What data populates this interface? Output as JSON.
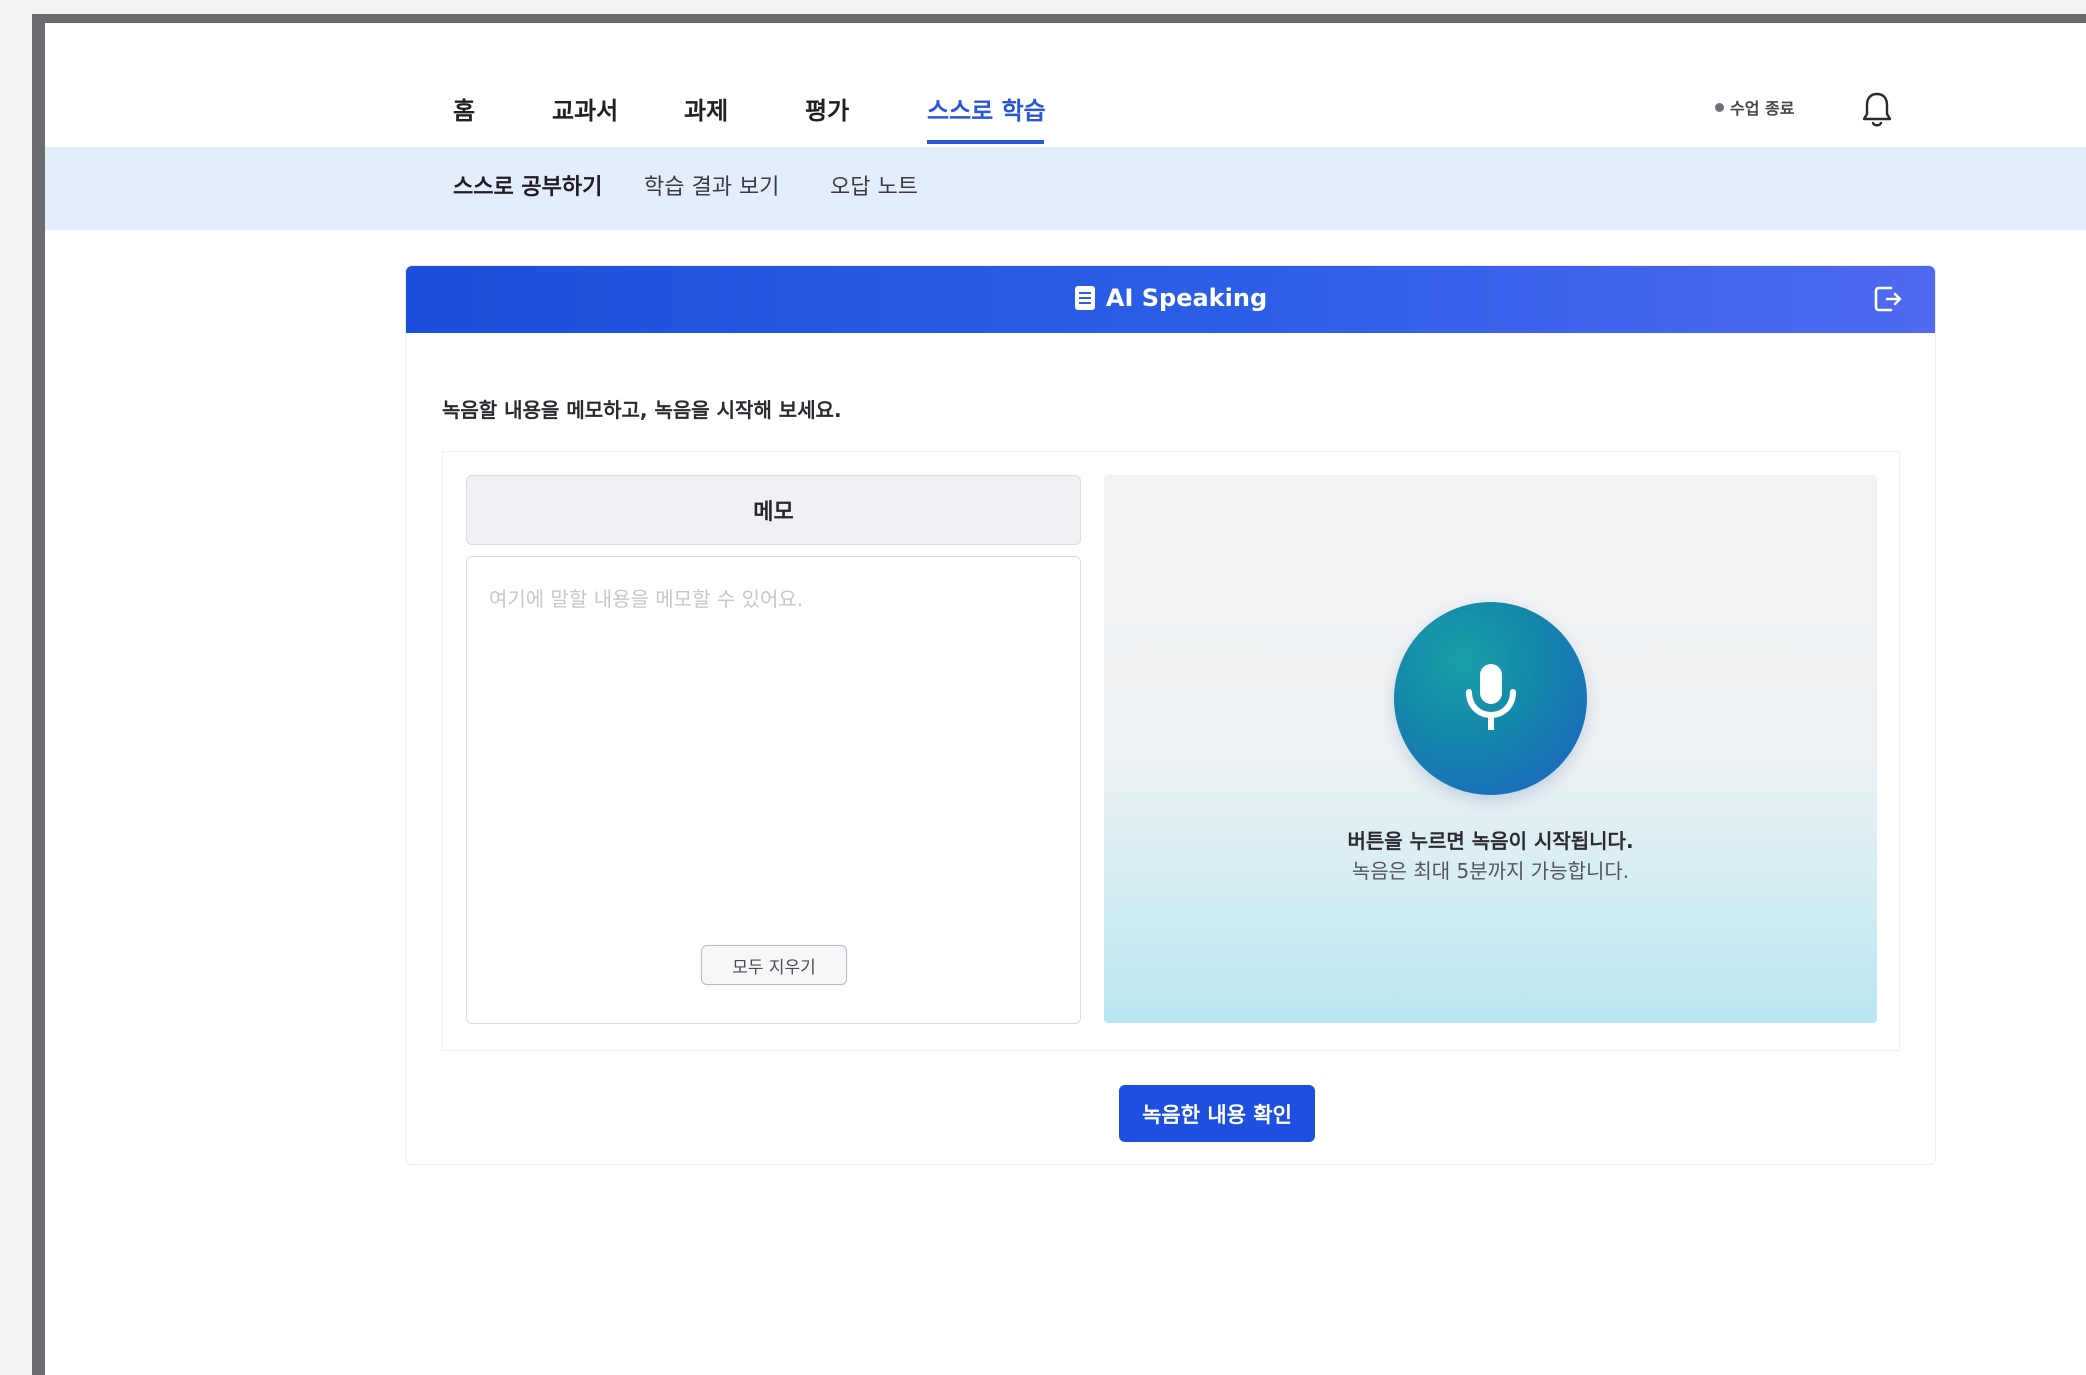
{
  "nav": {
    "items": [
      {
        "label": "홈"
      },
      {
        "label": "교과서"
      },
      {
        "label": "과제"
      },
      {
        "label": "평가"
      },
      {
        "label": "스스로 학습"
      }
    ],
    "active_index": 4,
    "session_label": "수업 종료",
    "bell_icon": "bell-icon"
  },
  "subnav": {
    "items": [
      {
        "label": "스스로 공부하기"
      },
      {
        "label": "학습 결과 보기"
      },
      {
        "label": "오답 노트"
      }
    ],
    "active_index": 0
  },
  "panel": {
    "title": "AI Speaking",
    "title_icon": "document-icon",
    "exit_icon": "exit-icon",
    "instruction": "녹음할 내용을 메모하고, 녹음을 시작해 보세요.",
    "memo": {
      "header": "메모",
      "placeholder": "여기에 말할 내용을 메모할 수 있어요.",
      "value": "",
      "clear_label": "모두 지우기"
    },
    "recorder": {
      "mic_icon": "microphone-icon",
      "line1": "버튼을 누르면 녹음이 시작됩니다.",
      "line2": "녹음은 최대 5분까지 가능합니다."
    },
    "confirm_label": "녹음한 내용 확인"
  },
  "colors": {
    "accent": "#2a56d8",
    "header_gradient_start": "#1c4fd9",
    "header_gradient_end": "#5069f1",
    "subnav_bg": "#e4edfb",
    "mic_start": "#1aa0a8",
    "mic_end": "#1f5fc4"
  }
}
